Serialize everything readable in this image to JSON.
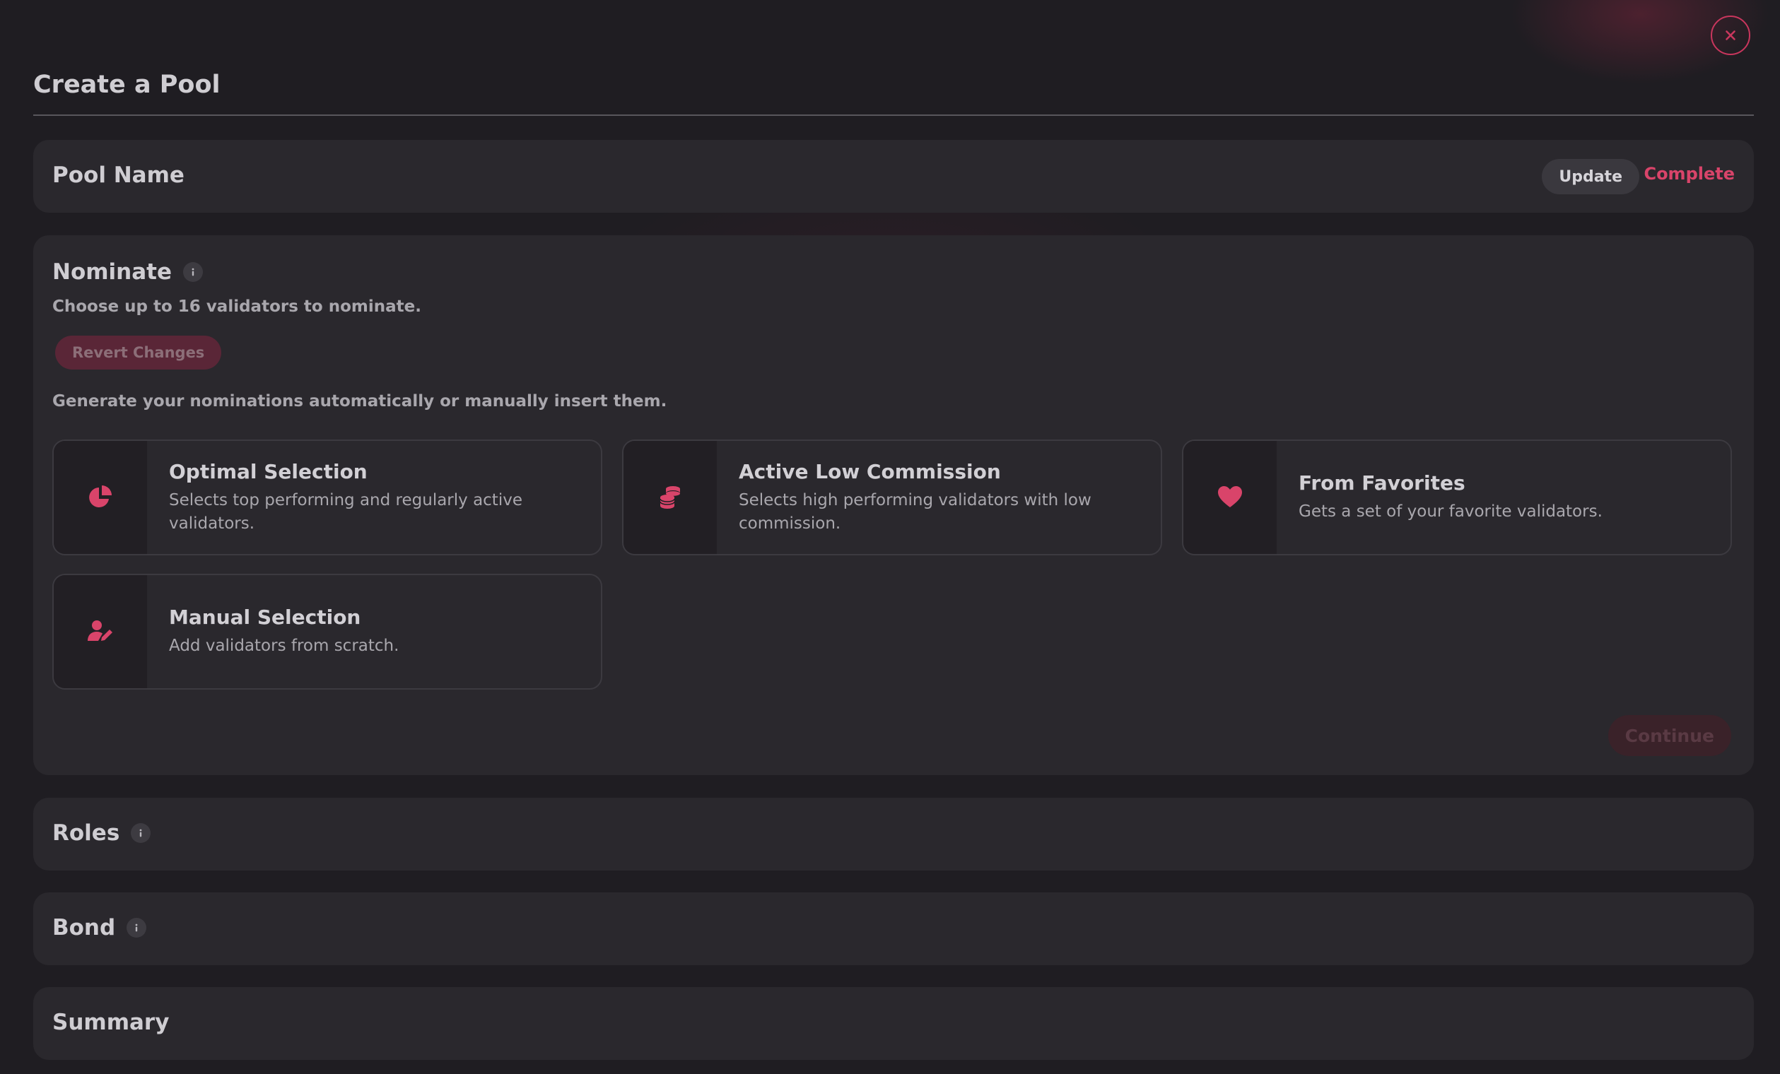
{
  "header": {
    "title": "Create a Pool"
  },
  "pool_name": {
    "title": "Pool Name",
    "update_label": "Update",
    "status_label": "Complete"
  },
  "nominate": {
    "title": "Nominate",
    "description": "Choose up to 16 validators to nominate.",
    "revert_label": "Revert Changes",
    "generate_text": "Generate your nominations automatically or manually insert them.",
    "options": [
      {
        "title": "Optimal Selection",
        "description": "Selects top performing and regularly active validators.",
        "icon": "pie-chart-icon"
      },
      {
        "title": "Active Low Commission",
        "description": "Selects high performing validators with low commission.",
        "icon": "coins-stack-icon"
      },
      {
        "title": "From Favorites",
        "description": "Gets a set of your favorite validators.",
        "icon": "heart-icon"
      },
      {
        "title": "Manual Selection",
        "description": "Add validators from scratch.",
        "icon": "user-edit-icon"
      }
    ],
    "continue_label": "Continue"
  },
  "roles": {
    "title": "Roles"
  },
  "bond": {
    "title": "Bond"
  },
  "summary": {
    "title": "Summary"
  },
  "colors": {
    "accent": "#d9446a",
    "background": "#1f1d22",
    "card": "#2a282d"
  }
}
